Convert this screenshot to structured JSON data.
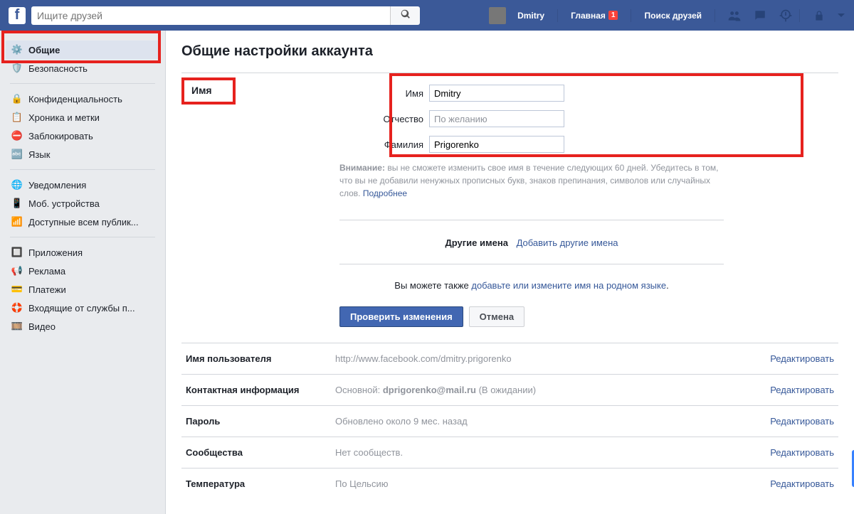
{
  "topbar": {
    "search_placeholder": "Ищите друзей",
    "user_name": "Dmitry",
    "home": "Главная",
    "home_badge": "1",
    "find_friends": "Поиск друзей"
  },
  "sidebar": {
    "group1": [
      {
        "label": "Общие"
      },
      {
        "label": "Безопасность"
      }
    ],
    "group2": [
      {
        "label": "Конфиденциальность"
      },
      {
        "label": "Хроника и метки"
      },
      {
        "label": "Заблокировать"
      },
      {
        "label": "Язык"
      }
    ],
    "group3": [
      {
        "label": "Уведомления"
      },
      {
        "label": "Моб. устройства"
      },
      {
        "label": "Доступные всем публик..."
      }
    ],
    "group4": [
      {
        "label": "Приложения"
      },
      {
        "label": "Реклама"
      },
      {
        "label": "Платежи"
      },
      {
        "label": "Входящие от службы п..."
      },
      {
        "label": "Видео"
      }
    ]
  },
  "page": {
    "heading": "Общие настройки аккаунта",
    "name_section_label": "Имя",
    "first_name_label": "Имя",
    "first_name_value": "Dmitry",
    "middle_name_label": "Отчество",
    "middle_name_placeholder": "По желанию",
    "last_name_label": "Фамилия",
    "last_name_value": "Prigorenko",
    "warning_bold": "Внимание:",
    "warning_text": " вы не сможете изменить свое имя в течение следующих 60 дней. Убедитесь в том, что вы не добавили ненужных прописных букв, знаков препинания, символов или случайных слов. ",
    "warning_more": "Подробнее",
    "other_names_label": "Другие имена",
    "other_names_link": "Добавить другие имена",
    "also_text": "Вы можете также ",
    "also_link": "добавьте или измените имя на родном языке",
    "also_period": ".",
    "btn_check": "Проверить изменения",
    "btn_cancel": "Отмена",
    "rows": {
      "username": {
        "label": "Имя пользователя",
        "prefix": "http://www.facebook.com/",
        "value": "dmitry.prigorenko",
        "edit": "Редактировать"
      },
      "contact": {
        "label": "Контактная информация",
        "prefix": "Основной: ",
        "email": "dprigorenko@mail.ru",
        "suffix": " (В ожидании)",
        "edit": "Редактировать"
      },
      "password": {
        "label": "Пароль",
        "value": "Обновлено около 9 мес. назад",
        "edit": "Редактировать"
      },
      "networks": {
        "label": "Сообщества",
        "value": "Нет сообществ.",
        "edit": "Редактировать"
      },
      "temperature": {
        "label": "Температура",
        "value": "По Цельсию",
        "edit": "Редактировать"
      }
    }
  }
}
